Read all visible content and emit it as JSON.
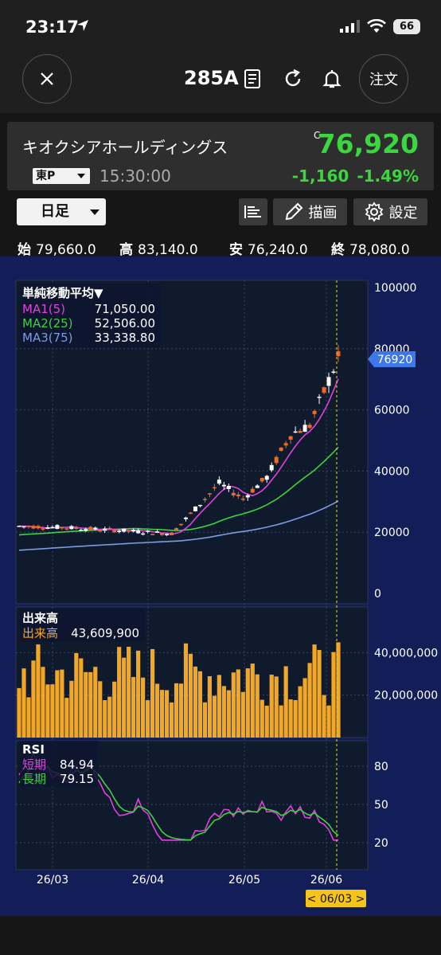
{
  "status_bar": {
    "time": "23:17",
    "battery": "66"
  },
  "header": {
    "ticker": "285A",
    "order_label": "注文"
  },
  "quote": {
    "name": "キオクシアホールディングス",
    "price_flag": "C",
    "price": "76,920",
    "exchange": "東P",
    "time": "15:30:00",
    "change": "-1,160",
    "change_pct": "-1.49%",
    "price_color": "#3bd640"
  },
  "toolbar": {
    "period": "日足",
    "draw_label": "描画",
    "settings_label": "設定"
  },
  "ohlc": {
    "open_label": "始",
    "open": "79,660.0",
    "high_label": "高",
    "high": "83,140.0",
    "low_label": "安",
    "low": "76,240.0",
    "close_label": "終",
    "close": "78,080.0"
  },
  "chart_data": [
    {
      "type": "candlestick",
      "x_labels": [
        "26/03",
        "26/04",
        "26/05",
        "26/06"
      ],
      "y_ticks": [
        "100000",
        "80000",
        "60000",
        "40000",
        "20000",
        "0"
      ],
      "ylim": [
        0,
        100000
      ],
      "current_price_label": "76920",
      "cursor_date_label": "< 06/03 >",
      "legend_title": "単純移動平均▼",
      "legend": [
        {
          "name": "MA1(5)",
          "value": "71,050.00",
          "color": "#e040e0"
        },
        {
          "name": "MA2(25)",
          "value": "52,506.00",
          "color": "#3fd13f"
        },
        {
          "name": "MA3(75)",
          "value": "33,338.80",
          "color": "#7a9ee0"
        }
      ],
      "candle_colors": {
        "up": "#ffffff",
        "down": "#f26a22"
      }
    },
    {
      "type": "bar",
      "legend_title": "出来高",
      "legend": [
        {
          "name": "出来高",
          "value": "43,609,900",
          "color": "#f5a623"
        }
      ],
      "y_ticks": [
        "40,000,000",
        "20,000,000"
      ],
      "ylim": [
        0,
        60000000
      ]
    },
    {
      "type": "line",
      "legend_title": "RSI",
      "legend": [
        {
          "name": "短期",
          "value": "84.94",
          "color": "#e040e0"
        },
        {
          "name": "長期",
          "value": "79.15",
          "color": "#3fd13f"
        }
      ],
      "y_ticks": [
        "80",
        "50",
        "20"
      ],
      "ylim": [
        0,
        100
      ]
    }
  ]
}
